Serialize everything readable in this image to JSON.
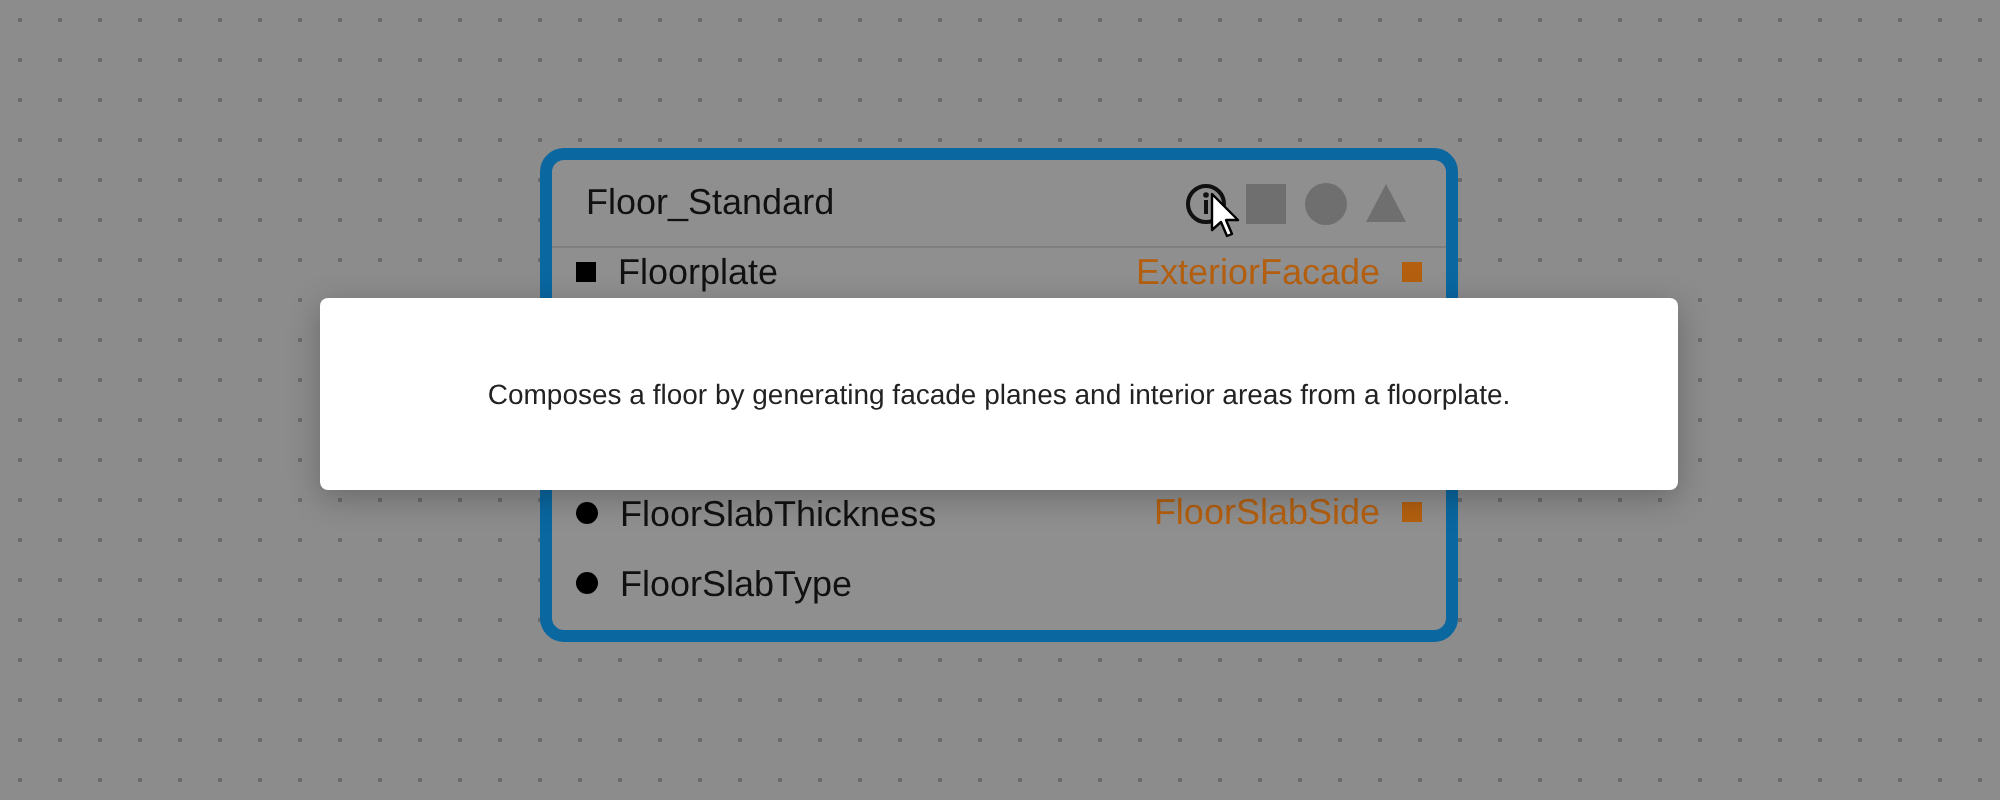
{
  "node": {
    "title": "Floor_Standard",
    "inputs": [
      {
        "label": "Floorplate",
        "kind": "square"
      },
      {
        "label": "FloorSlabThickness",
        "kind": "circle"
      },
      {
        "label": "FloorSlabType",
        "kind": "circle"
      }
    ],
    "outputs": [
      {
        "label": "ExteriorFacade",
        "kind": "square"
      },
      {
        "label": "FloorSlabSide",
        "kind": "square"
      }
    ]
  },
  "tooltip": {
    "text": "Composes a floor by generating facade planes and interior areas from a floorplate."
  }
}
